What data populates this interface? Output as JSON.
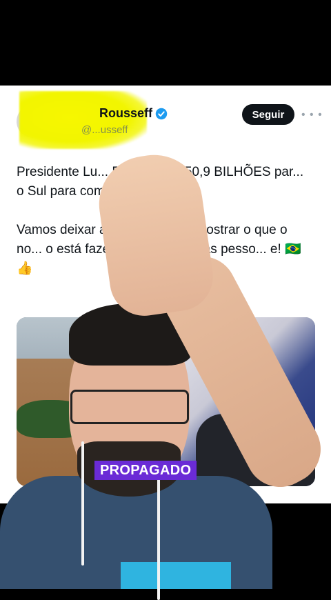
{
  "tweet": {
    "display_name": "Rousseff",
    "handle": "@...usseff",
    "follow_label": "Seguir",
    "more_label": "• • •",
    "paragraphs": [
      "Presidente Lu... ENVIAR R$ 50,9 BILHÕES par... o Sul para combater os e... vas.",
      "Vamos deixar as F... de lado e mostrar o que o no... o está fazendo em PROL das pesso... e! 🇧🇷 👍"
    ]
  },
  "video": {
    "caption": "PROPAGADO"
  },
  "colors": {
    "accent_verified": "#1d9bf0",
    "caption_bg": "#6a2bd6",
    "follow_bg": "#0f1419"
  }
}
